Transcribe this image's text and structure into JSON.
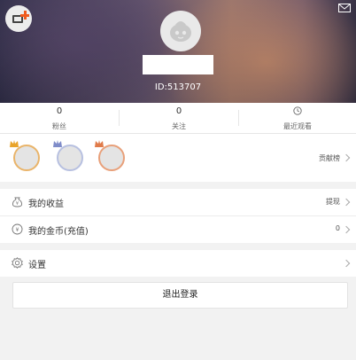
{
  "profile": {
    "id_text": "ID:513707"
  },
  "stats": [
    {
      "value": "0",
      "label": "粉丝"
    },
    {
      "value": "0",
      "label": "关注"
    },
    {
      "label": "最近观看",
      "icon": "clock-icon"
    }
  ],
  "contribution": {
    "label": "贡献榜",
    "ranks": [
      "gold",
      "silver",
      "bronze"
    ]
  },
  "menu": {
    "earnings": {
      "label": "我的收益",
      "action": "提现"
    },
    "coins": {
      "label": "我的金币(充值)",
      "value": "0"
    },
    "settings": {
      "label": "设置"
    }
  },
  "logout_label": "退出登录",
  "colors": {
    "accent": "#f05a1e",
    "gold": "#e9b46a",
    "silver": "#b7c0e0",
    "bronze": "#e8a07a"
  }
}
